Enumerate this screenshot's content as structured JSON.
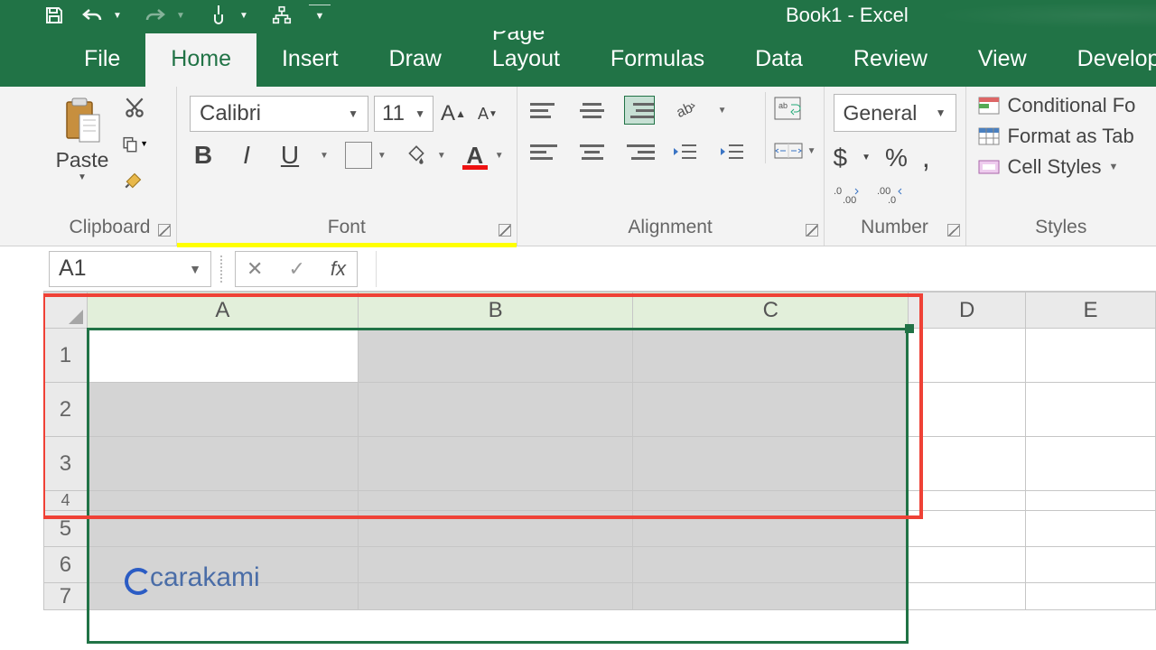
{
  "app": {
    "title": "Book1 - Excel"
  },
  "tabs": [
    "File",
    "Home",
    "Insert",
    "Draw",
    "Page Layout",
    "Formulas",
    "Data",
    "Review",
    "View",
    "Developer"
  ],
  "activeTab": "Home",
  "clipboard": {
    "paste": "Paste",
    "groupLabel": "Clipboard"
  },
  "font": {
    "name": "Calibri",
    "size": "11",
    "bold": "B",
    "italic": "I",
    "underline": "U",
    "groupLabel": "Font"
  },
  "alignment": {
    "groupLabel": "Alignment"
  },
  "number": {
    "format": "General",
    "groupLabel": "Number",
    "currency": "$",
    "percent": "%",
    "comma": ","
  },
  "styles": {
    "conditional": "Conditional Fo",
    "formatTable": "Format as Tab",
    "cellStyles": "Cell Styles",
    "groupLabel": "Styles"
  },
  "nameBox": "A1",
  "fxLabel": "fx",
  "columns": [
    "A",
    "B",
    "C",
    "D",
    "E"
  ],
  "rows": [
    "1",
    "2",
    "3",
    "4",
    "5",
    "6",
    "7"
  ],
  "watermark": "carakami"
}
